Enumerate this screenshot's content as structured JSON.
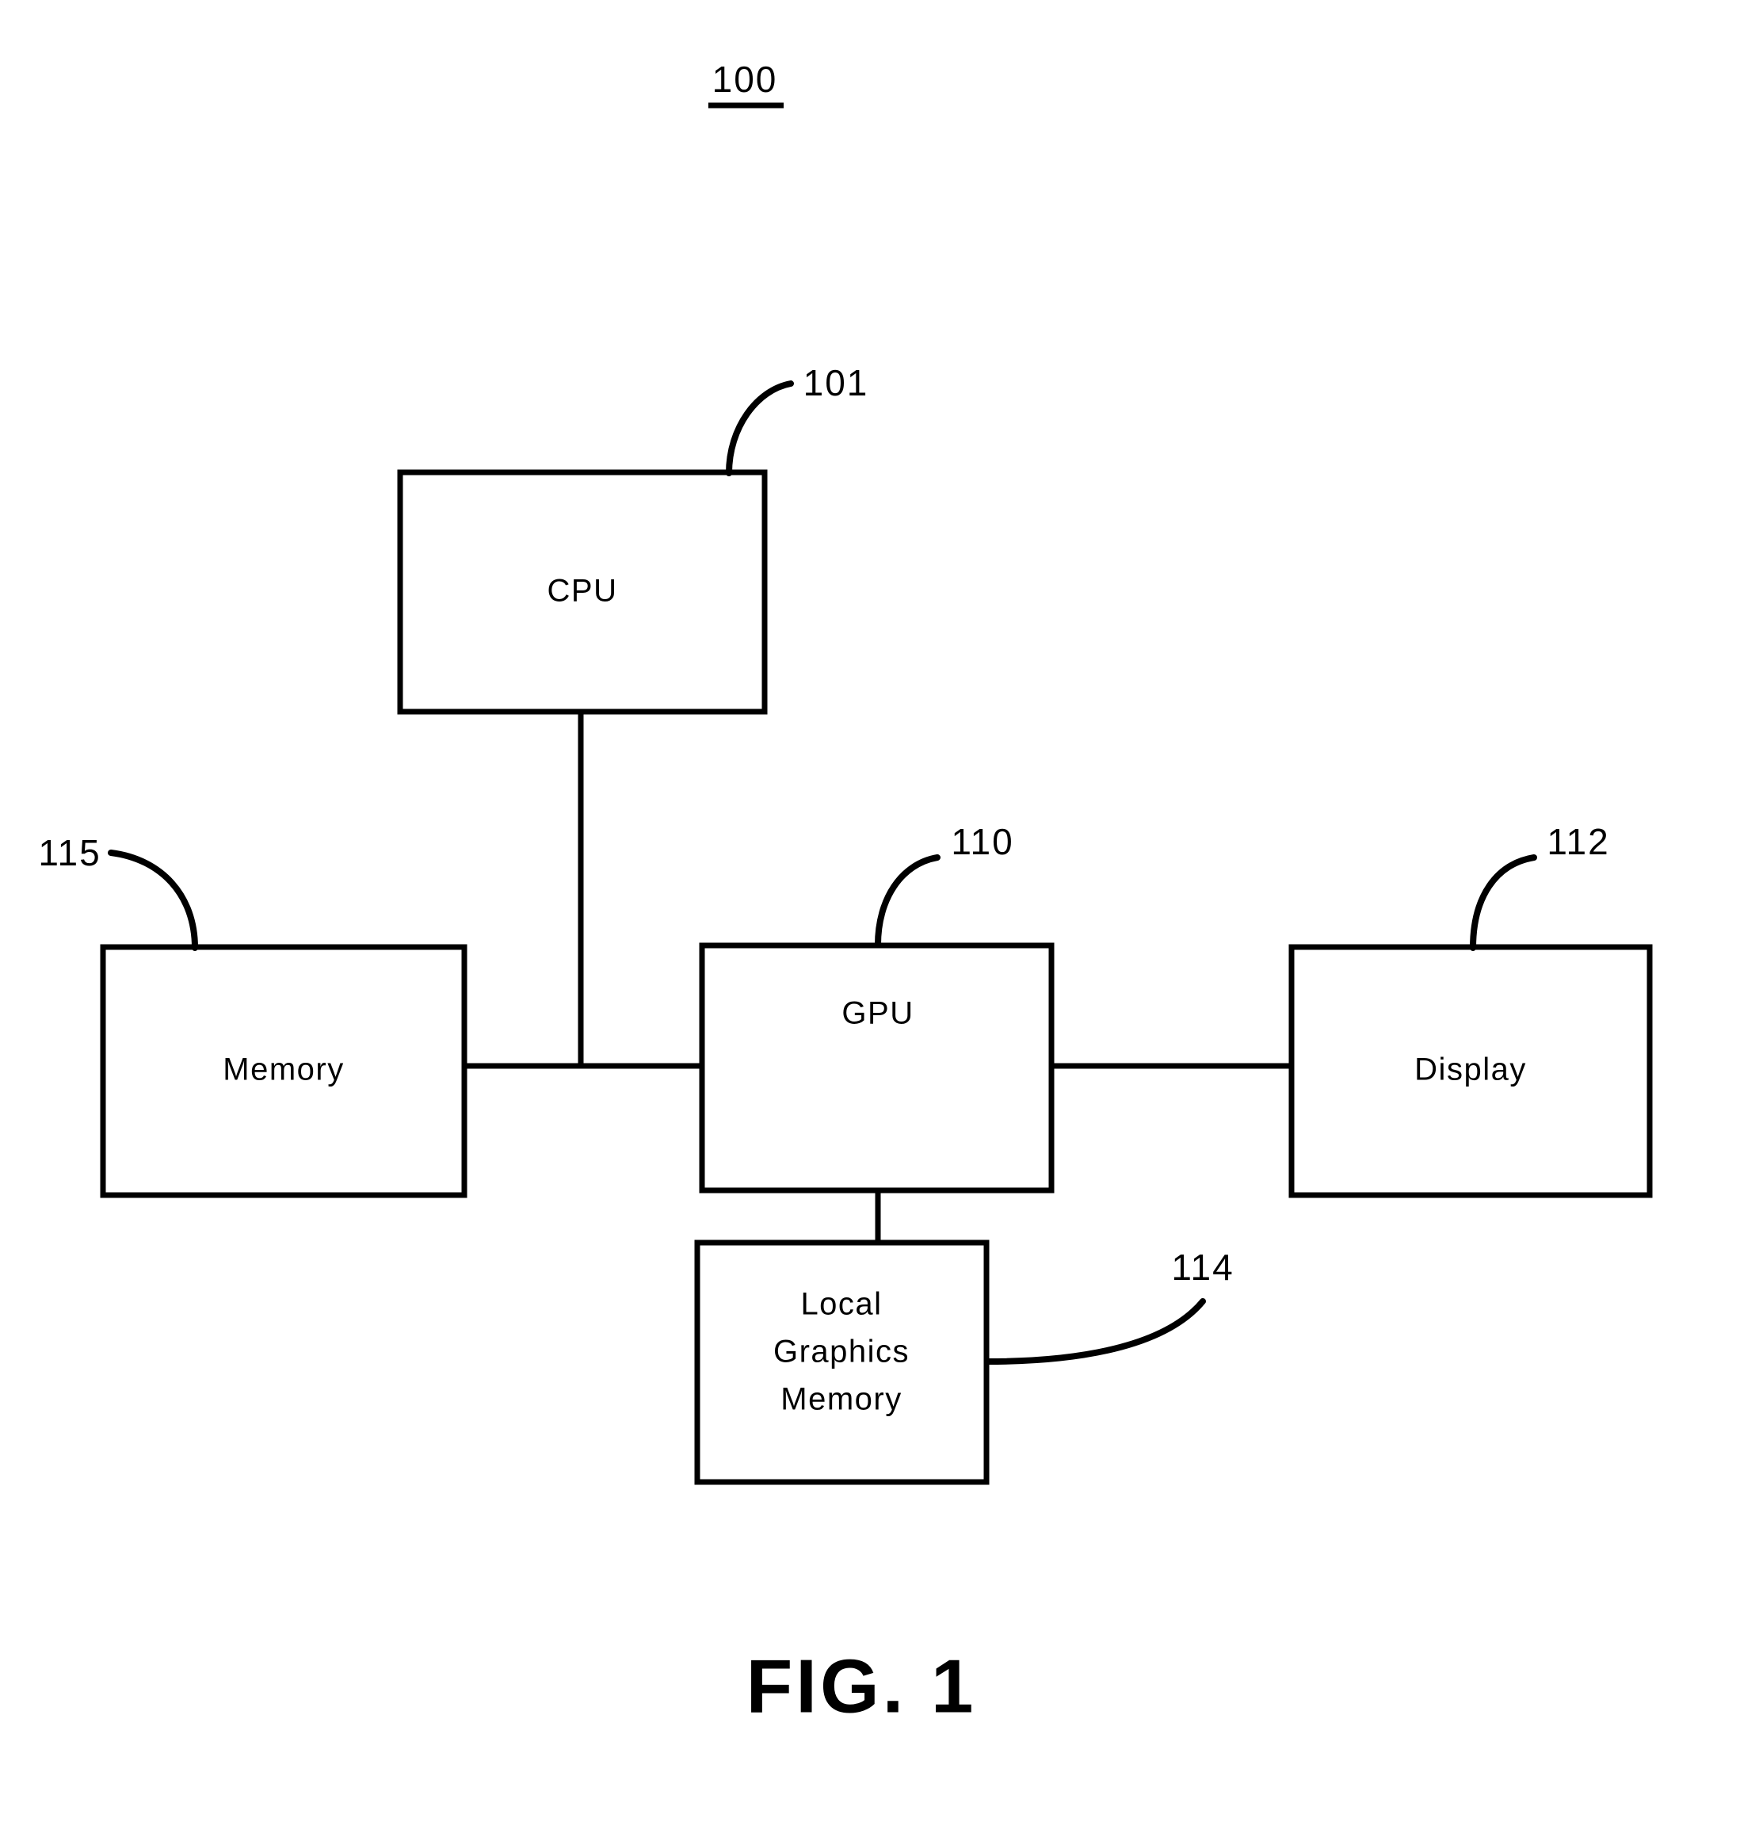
{
  "figure": {
    "title": "100",
    "caption": "FIG. 1",
    "boxes": [
      {
        "id": "cpu",
        "label": "CPU",
        "ref": "101"
      },
      {
        "id": "memory",
        "label": "Memory",
        "ref": "115"
      },
      {
        "id": "gpu",
        "label": "GPU",
        "ref": "110"
      },
      {
        "id": "display",
        "label": "Display",
        "ref": "112"
      },
      {
        "id": "lgm",
        "label_line1": "Local",
        "label_line2": "Graphics",
        "label_line3": "Memory",
        "ref": "114"
      }
    ]
  }
}
